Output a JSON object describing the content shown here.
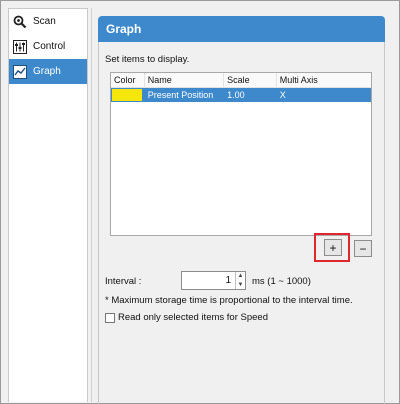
{
  "sidebar": {
    "items": [
      {
        "label": "Scan",
        "icon": "scan-icon",
        "active": false
      },
      {
        "label": "Control",
        "icon": "control-icon",
        "active": false
      },
      {
        "label": "Graph",
        "icon": "graph-icon",
        "active": true
      }
    ]
  },
  "panel": {
    "title": "Graph",
    "subtitle": "Set items to display."
  },
  "table": {
    "columns": [
      "Color",
      "Name",
      "Scale",
      "Multi Axis"
    ],
    "rows": [
      {
        "color": "#f5e60c",
        "name": "Present Position",
        "scale": "1.00",
        "multi_axis": "X"
      }
    ]
  },
  "buttons": {
    "add_label": "+",
    "remove_label": "−"
  },
  "interval": {
    "label": "Interval :",
    "value": "1",
    "unit": "ms (1 ~ 1000)"
  },
  "note": "* Maximum storage time is proportional to the interval time.",
  "checkbox": {
    "label": "Read only selected items for Speed",
    "checked": false
  },
  "colors": {
    "accent": "#3d89cc",
    "highlight": "#e0262f"
  }
}
